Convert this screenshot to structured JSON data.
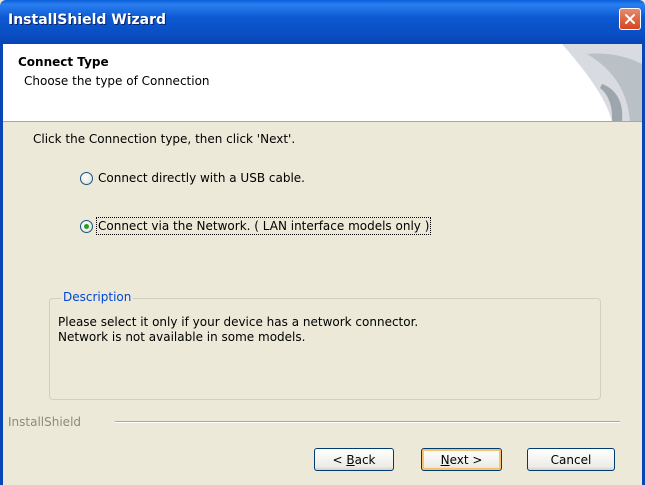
{
  "window": {
    "title": "InstallShield Wizard",
    "close_icon": "close-icon"
  },
  "header": {
    "title": "Connect Type",
    "subtitle": "Choose the type of Connection"
  },
  "instruction": "Click the Connection type, then click 'Next'.",
  "options": [
    {
      "label": "Connect directly with a USB cable.",
      "selected": false
    },
    {
      "label": "Connect via the Network. ( LAN interface models only )",
      "selected": true
    }
  ],
  "description": {
    "legend": "Description",
    "line1": "Please select it only if your device has a network connector.",
    "line2": "Network is not available in some models."
  },
  "brand": "InstallShield",
  "buttons": {
    "back_prefix": "< ",
    "back_accel": "B",
    "back_rest": "ack",
    "next_accel": "N",
    "next_rest": "ext >",
    "cancel": "Cancel"
  },
  "colors": {
    "titlebar": "#0a4fc4",
    "close": "#d4461e",
    "legend": "#0046d5",
    "radio_dot": "#21a121"
  }
}
